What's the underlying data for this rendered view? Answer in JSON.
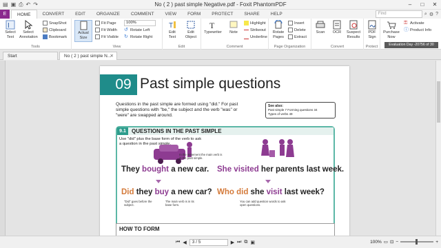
{
  "app": {
    "title": "No ( 2 ) past simple Negative.pdf - Foxit PhantomPDF"
  },
  "tabs": [
    "HOME",
    "CONVERT",
    "EDIT",
    "ORGANIZE",
    "COMMENT",
    "VIEW",
    "FORM",
    "PROTECT",
    "SHARE",
    "HELP"
  ],
  "file_tab": "E",
  "find_placeholder": "Find",
  "ribbon": {
    "tools": {
      "select_text": "Select\nText",
      "select_annotation": "Select\nAnnotation",
      "snapshot": "SnapShot",
      "clipboard": "Clipboard",
      "bookmark": "Bookmark",
      "label": "Tools"
    },
    "view": {
      "actual_size": "Actual\nSize",
      "fit_page": "Fit Page",
      "fit_width": "Fit Width",
      "fit_visible": "Fit Visible",
      "zoom": "100%",
      "rotate_left": "Rotate Left",
      "rotate_right": "Rotate Right",
      "label": "View"
    },
    "edit": {
      "edit_text": "Edit\nText",
      "edit_object": "Edit\nObject",
      "label": "Edit"
    },
    "comment": {
      "typewriter": "Typewriter",
      "note": "Note",
      "highlight": "Highlight",
      "strikeout": "Strikeout",
      "underline": "Underline",
      "label": "Comment"
    },
    "page_org": {
      "rotate_pages": "Rotate\nPages",
      "insert": "Insert",
      "delete": "Delete",
      "extract": "Extract",
      "label": "Page Organization"
    },
    "convert": {
      "scan": "Scan",
      "ocr": "OCR",
      "suspect": "Suspect\nResults",
      "label": "Convert"
    },
    "protect": {
      "pdf_sign": "PDF\nSign",
      "label": "Protect"
    },
    "purchase": {
      "purchase_now": "Purchase\nNow",
      "activate": "Activate",
      "product_info": "Product Info"
    },
    "evaluation": "Evaluation Day -20756 of 30"
  },
  "doc_tabs": [
    "Start",
    "No ( 2 ) past simple N..."
  ],
  "page": {
    "chapter_number": "09",
    "chapter_title": "Past simple questions",
    "intro": "Questions in the past simple are formed using \"did.\" For past simple questions with \"be,\" the subject and the verb \"was\" or \"were\" are swapped around.",
    "see_also": {
      "heading": "See also:",
      "line1": "Past simple 7  Forming questions 34",
      "line2": "Types of verbs 49"
    },
    "section_number": "9.1",
    "section_title": "QUESTIONS IN THE PAST SIMPLE",
    "use_line": "Use \"did\" plus the base form of the verb to ask a question in the past simple.",
    "note_main_verb_past": "In the statement the main verb is in the past simple.",
    "sentence1_a": "They ",
    "sentence1_b": "bought",
    "sentence1_c": " a new car.",
    "sentence2_a": "She ",
    "sentence2_b": "visited",
    "sentence2_c": " her parents last week.",
    "question1_a": "Did",
    "question1_b": " they ",
    "question1_c": "buy",
    "question1_d": " a new car?",
    "question2_a": "Who did",
    "question2_b": " she ",
    "question2_c": "visit",
    "question2_d": " last week?",
    "note_did_before": "\"Did\" goes before the subject.",
    "note_base_form": "The main verb is in its base form.",
    "note_question_words": "You can add question words to ask open questions.",
    "how_to_form": "HOW TO FORM"
  },
  "status": {
    "page_indicator": "3 / 5",
    "zoom": "100%"
  }
}
